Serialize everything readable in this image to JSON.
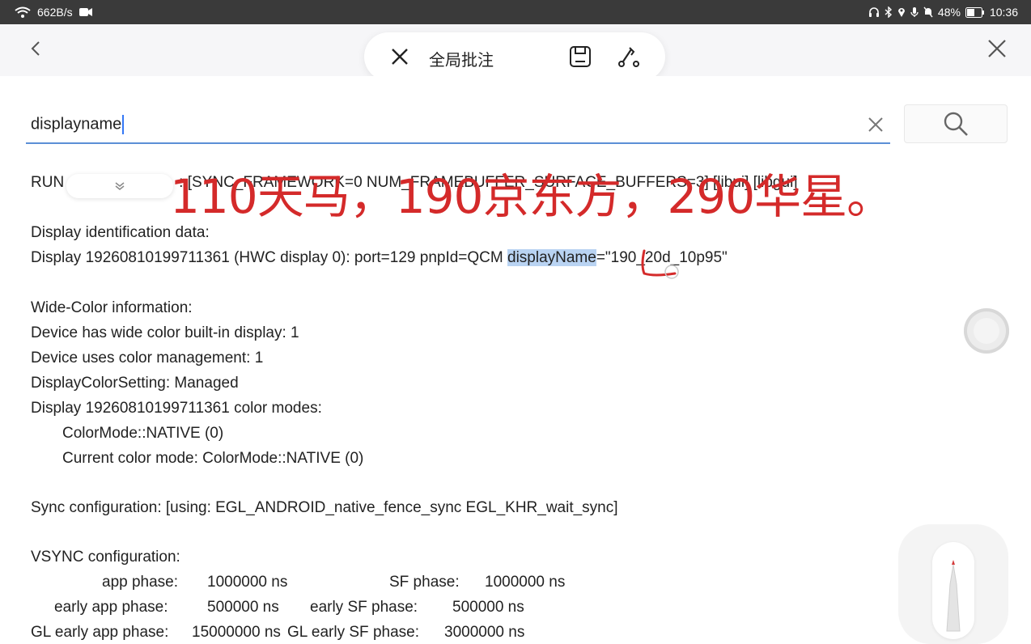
{
  "status": {
    "net_speed": "662B/s",
    "battery": "48%",
    "time": "10:36"
  },
  "toolbar": {
    "title": "全局批注"
  },
  "search": {
    "value": "displayname"
  },
  "annotation": {
    "text": "110天马，190京东方，290华星。"
  },
  "content": {
    "line0_a": "RUN",
    "line0_b": ": [SYNC_FRAMEWORK=0 NUM_FRAMEBUFFER_SURFACE_BUFFERS=3] [libui] [libgui]",
    "line1": "Display identification data:",
    "line2_a": "Display 19260810199711361 (HWC display 0): port=129 pnpId=QCM ",
    "line2_hl": "displayName",
    "line2_b": "=\"190_20d_10p95\"",
    "line3": "Wide-Color information:",
    "line4": "Device has wide color built-in display: 1",
    "line5": "Device uses color management: 1",
    "line6": "DisplayColorSetting: Managed",
    "line7": "Display 19260810199711361 color modes:",
    "line8": "ColorMode::NATIVE (0)",
    "line9": "Current color mode: ColorMode::NATIVE (0)",
    "line10": "Sync configuration: [using: EGL_ANDROID_native_fence_sync EGL_KHR_wait_sync]",
    "line11": "VSYNC configuration:",
    "vsync": {
      "r1_label": "app phase:",
      "r1_val": "1000000 ns",
      "r1_label2": "SF phase:",
      "r1_val2": "1000000 ns",
      "r2_label": "early app phase:",
      "r2_val": "500000 ns",
      "r2_label2": "early SF phase:",
      "r2_val2": "500000 ns",
      "r3_label": "GL early app phase:",
      "r3_val": "15000000 ns",
      "r3_label2": "GL early SF phase:",
      "r3_val2": "3000000 ns"
    }
  },
  "colors": {
    "highlight": "#b9d3f2",
    "annotation_red": "#d42a2a",
    "search_underline": "#5b8fd6"
  }
}
